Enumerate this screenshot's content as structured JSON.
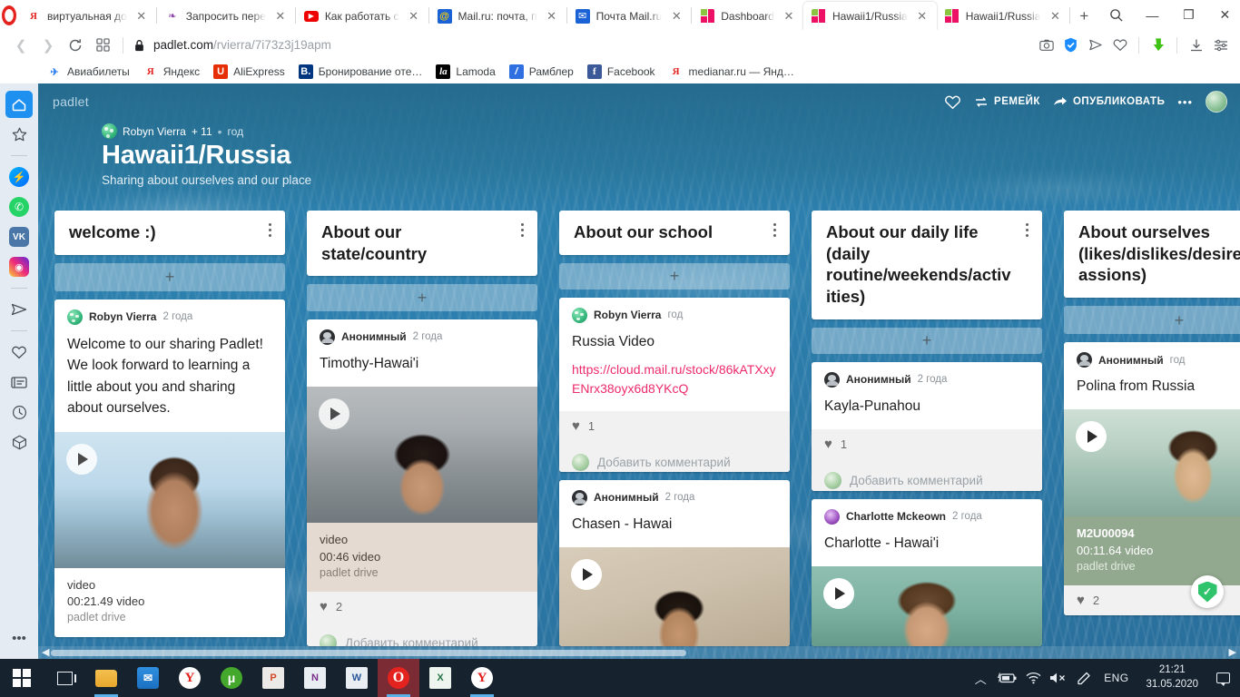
{
  "browser": {
    "tabs": [
      {
        "title": "виртуальная до",
        "favicon": "yandex-icon",
        "active": false
      },
      {
        "title": "Запросить пере",
        "favicon": "butterfly-icon",
        "active": false
      },
      {
        "title": "Как работать с",
        "favicon": "youtube-icon",
        "active": false
      },
      {
        "title": "Mail.ru: почта, п",
        "favicon": "mailru-icon",
        "active": false
      },
      {
        "title": "Почта Mail.ru",
        "favicon": "mailru-mail-icon",
        "active": false
      },
      {
        "title": "Dashboard",
        "favicon": "padlet-icon",
        "active": false
      },
      {
        "title": "Hawaii1/Russia",
        "favicon": "padlet-icon",
        "active": true
      },
      {
        "title": "Hawaii1/Russia",
        "favicon": "padlet-icon",
        "active": false
      }
    ],
    "new_tab_label": "+",
    "tab_search_icon": "search-icon",
    "window_minimize": "—",
    "window_restore": "❐",
    "window_close": "✕",
    "nav": {
      "back_icon": "chevron-left-icon",
      "forward_icon": "chevron-right-icon",
      "reload_icon": "reload-icon",
      "tiles_icon": "grid-icon",
      "lock_icon": "lock-icon"
    },
    "url": {
      "domain": "padlet.com",
      "path": "/rvierra/7i73z3j19apm"
    },
    "address_actions": [
      "camera-icon",
      "shield-check-icon",
      "send-icon",
      "heart-icon",
      "download-arrow-icon",
      "downloads-icon",
      "settings-sliders-icon"
    ],
    "bookmarks": [
      {
        "label": "Авиабилеты",
        "icon": "plane-icon"
      },
      {
        "label": "Яндекс",
        "icon": "yandex-icon"
      },
      {
        "label": "AliExpress",
        "icon": "aliexpress-icon"
      },
      {
        "label": "Бронирование оте…",
        "icon": "booking-icon"
      },
      {
        "label": "Lamoda",
        "icon": "lamoda-icon"
      },
      {
        "label": "Рамблер",
        "icon": "rambler-icon"
      },
      {
        "label": "Facebook",
        "icon": "facebook-icon"
      },
      {
        "label": "medianar.ru — Янд…",
        "icon": "yandex-icon"
      }
    ],
    "sidebar_rail": [
      {
        "name": "home-icon",
        "selected": true
      },
      {
        "name": "star-icon",
        "selected": false
      },
      {
        "name": "divider",
        "selected": false
      },
      {
        "name": "messenger-icon",
        "selected": false
      },
      {
        "name": "whatsapp-icon",
        "selected": false
      },
      {
        "name": "vk-icon",
        "selected": false
      },
      {
        "name": "instagram-icon",
        "selected": false
      },
      {
        "name": "divider",
        "selected": false
      },
      {
        "name": "telegram-icon",
        "selected": false
      },
      {
        "name": "divider",
        "selected": false
      },
      {
        "name": "heart-icon",
        "selected": false
      },
      {
        "name": "news-icon",
        "selected": false
      },
      {
        "name": "history-icon",
        "selected": false
      },
      {
        "name": "package-icon",
        "selected": false
      },
      {
        "name": "more-icon",
        "selected": false
      }
    ]
  },
  "padlet": {
    "brand": "padlet",
    "owner": "Robyn Vierra",
    "collaborators": "+ 11",
    "separator": "•",
    "updated": "год",
    "title": "Hawaii1/Russia",
    "subtitle": "Sharing about ourselves and our place",
    "actions": {
      "favorite_icon": "heart-icon",
      "remake_label": "РЕМЕЙК",
      "remake_icon": "remake-icon",
      "share_label": "ОПУБЛИКОВАТЬ",
      "share_icon": "share-arrow-icon",
      "more_label": "•••",
      "avatar": "user-avatar"
    },
    "add_label": "+",
    "comment_placeholder": "Добавить комментарий",
    "columns": [
      {
        "title": "welcome :)",
        "posts": [
          {
            "author": "Robyn Vierra",
            "avatar": "robyn",
            "time": "2 года",
            "text": "Welcome to our sharing Padlet! We look forward to learning a little about you and sharing about ourselves.",
            "media": {
              "thumb": "vid-robyn",
              "caption_name": "video",
              "caption_sub": "00:21.49 video",
              "caption_src": "padlet drive",
              "caption_style": "plain"
            }
          }
        ]
      },
      {
        "title": "About our state/country",
        "posts": [
          {
            "author": "Анонимный",
            "avatar": "anon",
            "time": "2 года",
            "title": "Timothy-Hawai'i",
            "media": {
              "thumb": "vid-timothy",
              "caption_name": "video",
              "caption_sub": "00:46 video",
              "caption_src": "padlet drive",
              "caption_style": "tan"
            },
            "likes": "2",
            "has_comment_row": true
          }
        ]
      },
      {
        "title": "About our school",
        "posts": [
          {
            "author": "Robyn Vierra",
            "avatar": "robyn",
            "time": "год",
            "title": "Russia Video",
            "link": "https://cloud.mail.ru/stock/86kATXxyENrx38oyx6d8YKcQ",
            "likes": "1",
            "has_comment_row": true
          },
          {
            "author": "Анонимный",
            "avatar": "anon",
            "time": "2 года",
            "title": "Chasen - Hawai",
            "media": {
              "thumb": "vid-chasen",
              "caption_style": "none"
            }
          }
        ]
      },
      {
        "title": "About our daily life (daily routine/weekends/activities)",
        "posts": [
          {
            "author": "Анонимный",
            "avatar": "anon",
            "time": "2 года",
            "title": "Kayla-Punahou",
            "likes": "1",
            "has_comment_row": true
          },
          {
            "author": "Charlotte Mckeown",
            "avatar": "charlotte",
            "time": "2 года",
            "title": "Charlotte - Hawai'i",
            "media": {
              "thumb": "vid-charlotte",
              "caption_style": "none"
            }
          }
        ]
      },
      {
        "title": "About ourselves (likes/dislikes/desires/passions)",
        "posts": [
          {
            "author": "Анонимный",
            "avatar": "anon",
            "time": "год",
            "title": "Polina from Russia",
            "media": {
              "thumb": "vid-polina",
              "caption_name": "M2U00094",
              "caption_sub": "00:11.64 video",
              "caption_src": "padlet drive",
              "caption_style": "green"
            },
            "likes": "2"
          }
        ]
      }
    ]
  },
  "taskbar": {
    "start_icon": "windows-start-icon",
    "items": [
      {
        "name": "task-view-icon",
        "label": ""
      },
      {
        "name": "file-explorer-icon",
        "label": ""
      },
      {
        "name": "mail-icon",
        "label": ""
      },
      {
        "name": "yandex-icon",
        "label": "Y"
      },
      {
        "name": "utorrent-icon",
        "label": "μ"
      },
      {
        "name": "publisher-icon",
        "label": "P"
      },
      {
        "name": "onenote-icon",
        "label": "N"
      },
      {
        "name": "word-icon",
        "label": "W"
      },
      {
        "name": "opera-icon",
        "label": "O"
      },
      {
        "name": "excel-icon",
        "label": "X"
      },
      {
        "name": "yandex-browser-icon",
        "label": "Y"
      }
    ],
    "tray": {
      "expand_icon": "chevron-up-icon",
      "battery_icon": "battery-charging-icon",
      "wifi_icon": "wifi-icon",
      "volume_icon": "volume-muted-icon",
      "pen_icon": "pen-icon",
      "language": "ENG",
      "time": "21:21",
      "date": "31.05.2020",
      "notifications_icon": "notification-icon"
    }
  }
}
